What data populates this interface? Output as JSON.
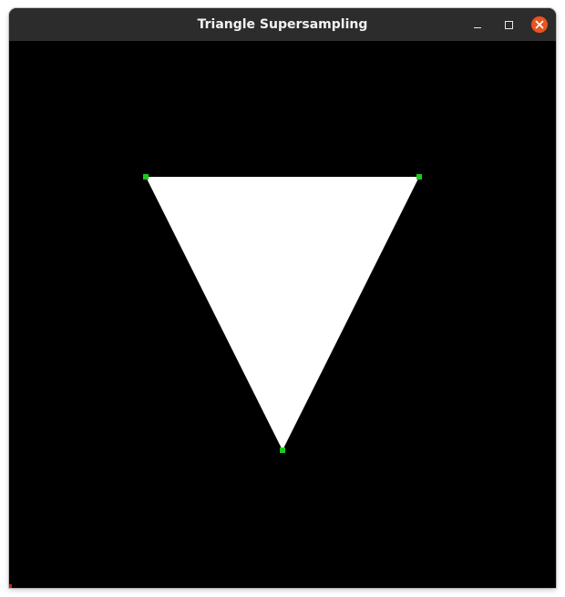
{
  "window": {
    "title": "Triangle Supersampling"
  },
  "controls": {
    "minimize_icon": "minimize-icon",
    "maximize_icon": "maximize-icon",
    "close_icon": "close-icon",
    "close_color": "#e95420"
  },
  "canvas": {
    "background": "#000000",
    "triangle_fill": "#ffffff",
    "vertex_marker_color": "#1ec81e",
    "corner_marker_color": "#cc2200"
  }
}
